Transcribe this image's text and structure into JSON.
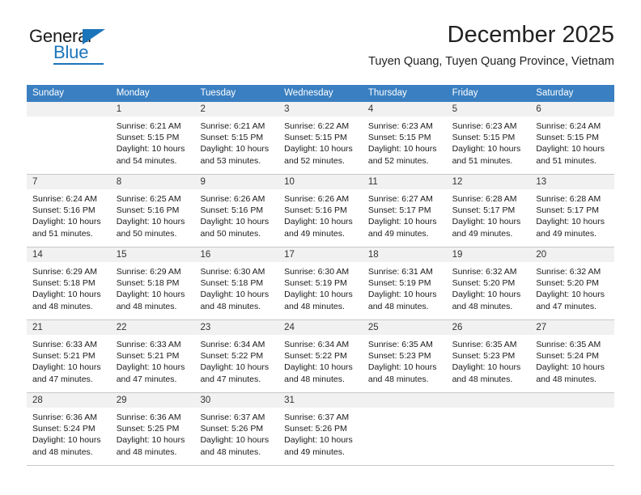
{
  "logo": {
    "word1": "General",
    "word2": "Blue",
    "icon": "triangle-logo-mark"
  },
  "header": {
    "title": "December 2025",
    "subtitle": "Tuyen Quang, Tuyen Quang Province, Vietnam"
  },
  "colors": {
    "header_blue": "#3a7fc1",
    "daynum_band": "#f1f1f1",
    "logo_blue": "#1b75bb",
    "grid_line": "#c8c8c8"
  },
  "weekdays": [
    "Sunday",
    "Monday",
    "Tuesday",
    "Wednesday",
    "Thursday",
    "Friday",
    "Saturday"
  ],
  "weeks": [
    [
      {
        "day": "",
        "empty": true,
        "lines": []
      },
      {
        "day": "1",
        "lines": [
          "Sunrise: 6:21 AM",
          "Sunset: 5:15 PM",
          "Daylight: 10 hours",
          "and 54 minutes."
        ]
      },
      {
        "day": "2",
        "lines": [
          "Sunrise: 6:21 AM",
          "Sunset: 5:15 PM",
          "Daylight: 10 hours",
          "and 53 minutes."
        ]
      },
      {
        "day": "3",
        "lines": [
          "Sunrise: 6:22 AM",
          "Sunset: 5:15 PM",
          "Daylight: 10 hours",
          "and 52 minutes."
        ]
      },
      {
        "day": "4",
        "lines": [
          "Sunrise: 6:23 AM",
          "Sunset: 5:15 PM",
          "Daylight: 10 hours",
          "and 52 minutes."
        ]
      },
      {
        "day": "5",
        "lines": [
          "Sunrise: 6:23 AM",
          "Sunset: 5:15 PM",
          "Daylight: 10 hours",
          "and 51 minutes."
        ]
      },
      {
        "day": "6",
        "lines": [
          "Sunrise: 6:24 AM",
          "Sunset: 5:15 PM",
          "Daylight: 10 hours",
          "and 51 minutes."
        ]
      }
    ],
    [
      {
        "day": "7",
        "lines": [
          "Sunrise: 6:24 AM",
          "Sunset: 5:16 PM",
          "Daylight: 10 hours",
          "and 51 minutes."
        ]
      },
      {
        "day": "8",
        "lines": [
          "Sunrise: 6:25 AM",
          "Sunset: 5:16 PM",
          "Daylight: 10 hours",
          "and 50 minutes."
        ]
      },
      {
        "day": "9",
        "lines": [
          "Sunrise: 6:26 AM",
          "Sunset: 5:16 PM",
          "Daylight: 10 hours",
          "and 50 minutes."
        ]
      },
      {
        "day": "10",
        "lines": [
          "Sunrise: 6:26 AM",
          "Sunset: 5:16 PM",
          "Daylight: 10 hours",
          "and 49 minutes."
        ]
      },
      {
        "day": "11",
        "lines": [
          "Sunrise: 6:27 AM",
          "Sunset: 5:17 PM",
          "Daylight: 10 hours",
          "and 49 minutes."
        ]
      },
      {
        "day": "12",
        "lines": [
          "Sunrise: 6:28 AM",
          "Sunset: 5:17 PM",
          "Daylight: 10 hours",
          "and 49 minutes."
        ]
      },
      {
        "day": "13",
        "lines": [
          "Sunrise: 6:28 AM",
          "Sunset: 5:17 PM",
          "Daylight: 10 hours",
          "and 49 minutes."
        ]
      }
    ],
    [
      {
        "day": "14",
        "lines": [
          "Sunrise: 6:29 AM",
          "Sunset: 5:18 PM",
          "Daylight: 10 hours",
          "and 48 minutes."
        ]
      },
      {
        "day": "15",
        "lines": [
          "Sunrise: 6:29 AM",
          "Sunset: 5:18 PM",
          "Daylight: 10 hours",
          "and 48 minutes."
        ]
      },
      {
        "day": "16",
        "lines": [
          "Sunrise: 6:30 AM",
          "Sunset: 5:18 PM",
          "Daylight: 10 hours",
          "and 48 minutes."
        ]
      },
      {
        "day": "17",
        "lines": [
          "Sunrise: 6:30 AM",
          "Sunset: 5:19 PM",
          "Daylight: 10 hours",
          "and 48 minutes."
        ]
      },
      {
        "day": "18",
        "lines": [
          "Sunrise: 6:31 AM",
          "Sunset: 5:19 PM",
          "Daylight: 10 hours",
          "and 48 minutes."
        ]
      },
      {
        "day": "19",
        "lines": [
          "Sunrise: 6:32 AM",
          "Sunset: 5:20 PM",
          "Daylight: 10 hours",
          "and 48 minutes."
        ]
      },
      {
        "day": "20",
        "lines": [
          "Sunrise: 6:32 AM",
          "Sunset: 5:20 PM",
          "Daylight: 10 hours",
          "and 47 minutes."
        ]
      }
    ],
    [
      {
        "day": "21",
        "lines": [
          "Sunrise: 6:33 AM",
          "Sunset: 5:21 PM",
          "Daylight: 10 hours",
          "and 47 minutes."
        ]
      },
      {
        "day": "22",
        "lines": [
          "Sunrise: 6:33 AM",
          "Sunset: 5:21 PM",
          "Daylight: 10 hours",
          "and 47 minutes."
        ]
      },
      {
        "day": "23",
        "lines": [
          "Sunrise: 6:34 AM",
          "Sunset: 5:22 PM",
          "Daylight: 10 hours",
          "and 47 minutes."
        ]
      },
      {
        "day": "24",
        "lines": [
          "Sunrise: 6:34 AM",
          "Sunset: 5:22 PM",
          "Daylight: 10 hours",
          "and 48 minutes."
        ]
      },
      {
        "day": "25",
        "lines": [
          "Sunrise: 6:35 AM",
          "Sunset: 5:23 PM",
          "Daylight: 10 hours",
          "and 48 minutes."
        ]
      },
      {
        "day": "26",
        "lines": [
          "Sunrise: 6:35 AM",
          "Sunset: 5:23 PM",
          "Daylight: 10 hours",
          "and 48 minutes."
        ]
      },
      {
        "day": "27",
        "lines": [
          "Sunrise: 6:35 AM",
          "Sunset: 5:24 PM",
          "Daylight: 10 hours",
          "and 48 minutes."
        ]
      }
    ],
    [
      {
        "day": "28",
        "lines": [
          "Sunrise: 6:36 AM",
          "Sunset: 5:24 PM",
          "Daylight: 10 hours",
          "and 48 minutes."
        ]
      },
      {
        "day": "29",
        "lines": [
          "Sunrise: 6:36 AM",
          "Sunset: 5:25 PM",
          "Daylight: 10 hours",
          "and 48 minutes."
        ]
      },
      {
        "day": "30",
        "lines": [
          "Sunrise: 6:37 AM",
          "Sunset: 5:26 PM",
          "Daylight: 10 hours",
          "and 48 minutes."
        ]
      },
      {
        "day": "31",
        "lines": [
          "Sunrise: 6:37 AM",
          "Sunset: 5:26 PM",
          "Daylight: 10 hours",
          "and 49 minutes."
        ]
      },
      {
        "day": "",
        "empty": true,
        "lines": []
      },
      {
        "day": "",
        "empty": true,
        "lines": []
      },
      {
        "day": "",
        "empty": true,
        "lines": []
      }
    ]
  ]
}
